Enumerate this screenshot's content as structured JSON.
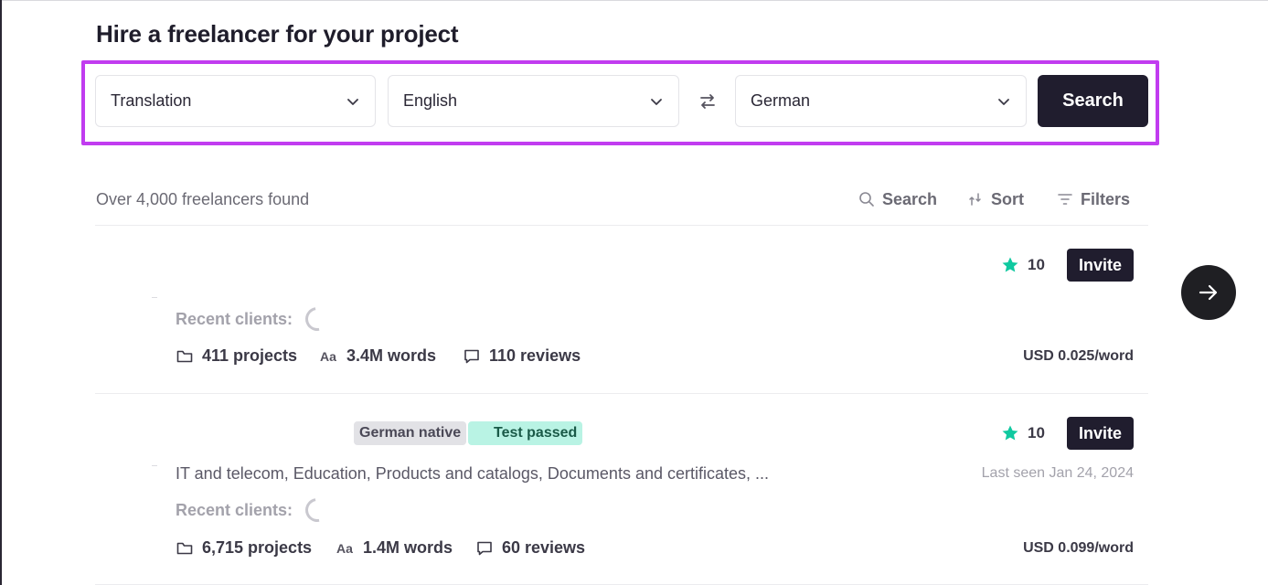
{
  "page": {
    "title": "Hire a freelancer for your project"
  },
  "search": {
    "service": "Translation",
    "source_language": "English",
    "target_language": "German",
    "button_label": "Search",
    "highlight_color": "#c13cf0"
  },
  "results": {
    "count_text": "Over 4,000 freelancers found",
    "tools": {
      "search_label": "Search",
      "sort_label": "Sort",
      "filters_label": "Filters"
    }
  },
  "freelancers": [
    {
      "rating": "10",
      "invite_label": "Invite",
      "recent_clients_label": "Recent clients:",
      "projects": "411 projects",
      "words": "3.4M words",
      "reviews": "110 reviews",
      "price": "USD 0.025/word"
    },
    {
      "badges": [
        "German native",
        "Test passed"
      ],
      "rating": "10",
      "invite_label": "Invite",
      "specialties": "IT and telecom, Education, Products and catalogs, Documents and certificates, ...",
      "last_seen": "Last seen Jan 24, 2024",
      "recent_clients_label": "Recent clients:",
      "projects": "6,715 projects",
      "words": "1.4M words",
      "reviews": "60 reviews",
      "price": "USD 0.099/word"
    }
  ],
  "icons": {
    "words_glyph": "Aa"
  },
  "colors": {
    "primary_dark": "#201d2e",
    "star": "#10c9a0",
    "muted_text": "#a3a2ab"
  }
}
